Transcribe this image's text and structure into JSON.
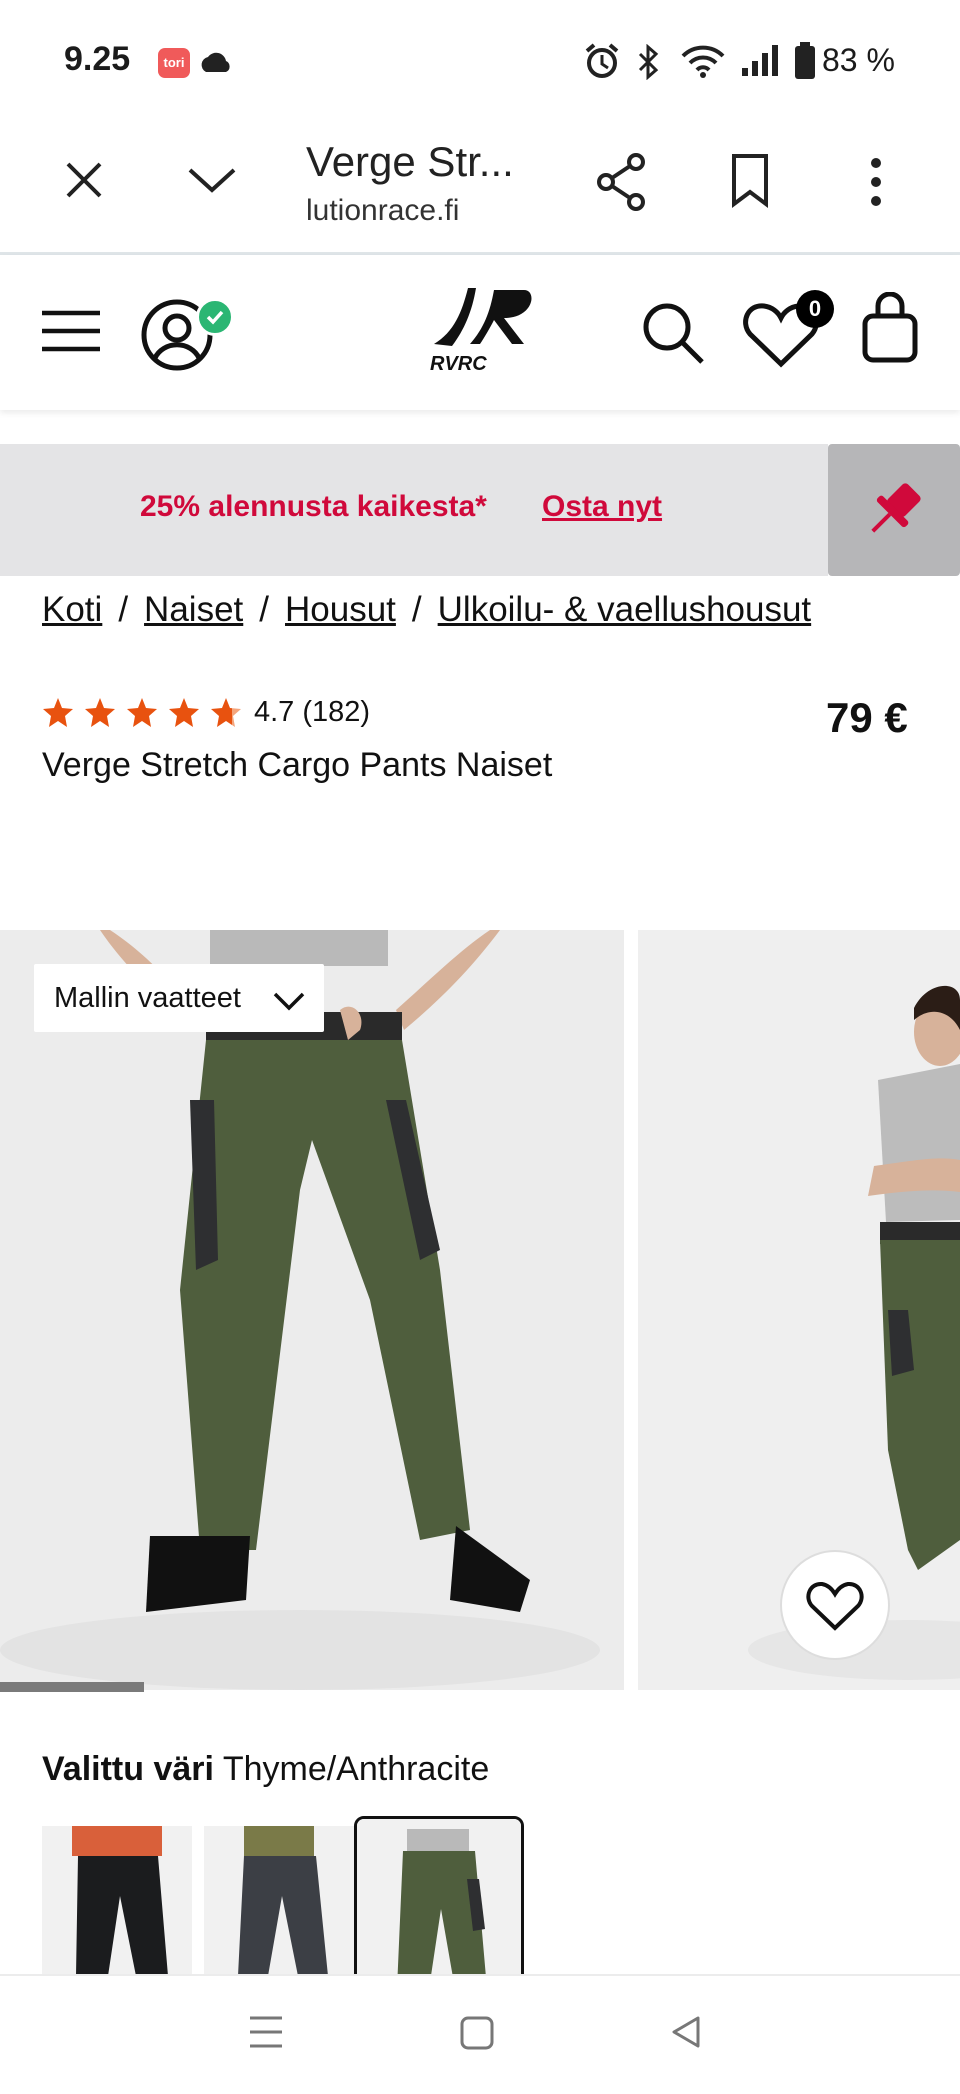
{
  "status": {
    "time": "9.25",
    "tori": "tori",
    "battery": "83 %"
  },
  "browser": {
    "title": "Verge Str...",
    "url": "lutionrace.fi"
  },
  "header": {
    "wishlist_count": "0",
    "logo_text": "RVRC"
  },
  "promo": {
    "text": "25% alennusta kaikesta*",
    "link": "Osta nyt"
  },
  "breadcrumb": [
    "Koti",
    "Naiset",
    "Housut",
    "Ulkoilu- & vaellushousut"
  ],
  "product": {
    "rating": 4.7,
    "rating_text": "4.7 (182)",
    "name": "Verge Stretch Cargo Pants Naiset",
    "price": "79 €"
  },
  "gallery": {
    "model_button": "Mallin vaatteet"
  },
  "color": {
    "label": "Valittu väri",
    "value": "Thyme/Anthracite"
  },
  "colors": {
    "accent": "#d0093b",
    "star": "#e8520f",
    "pants_green": "#4f5e3d"
  }
}
